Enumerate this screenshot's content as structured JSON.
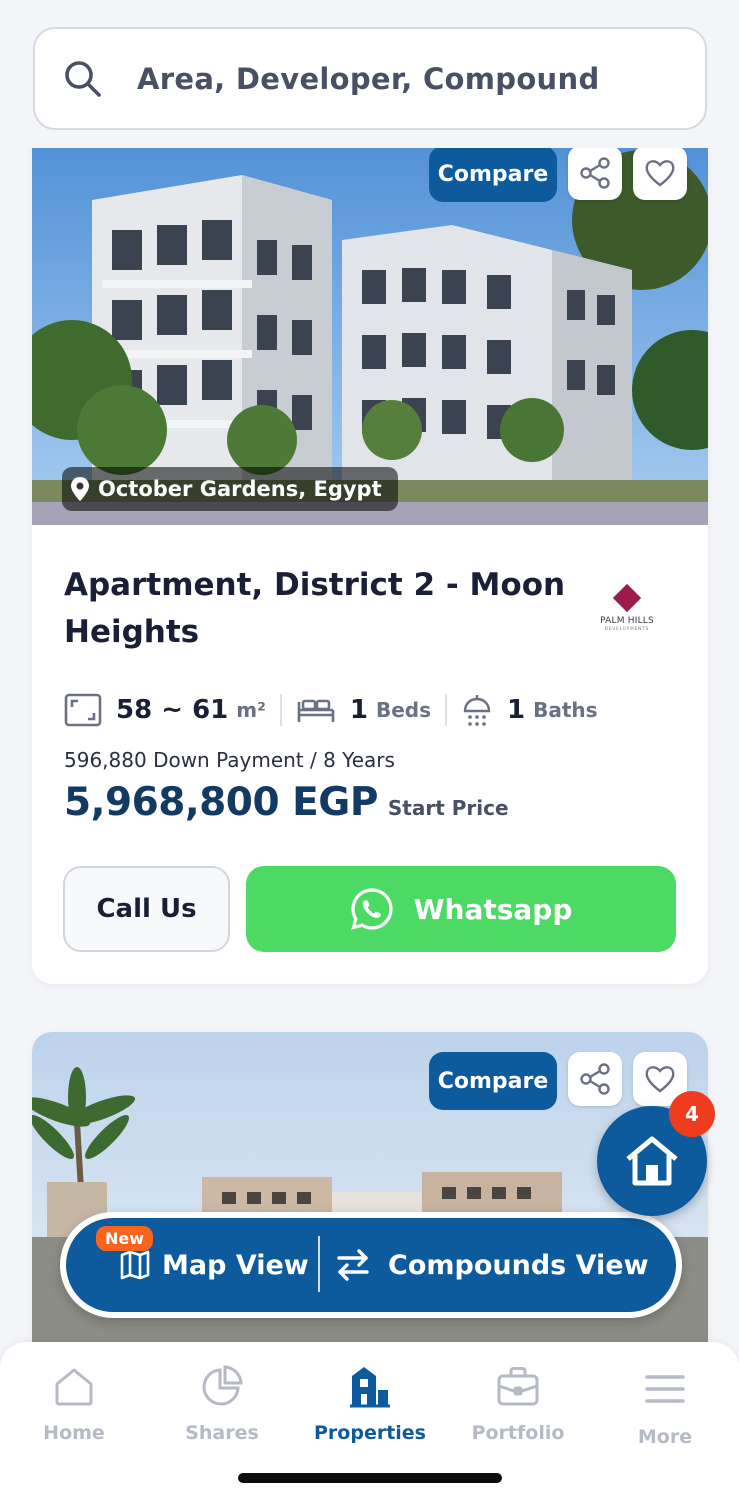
{
  "search": {
    "placeholder": "Area, Developer, Compound"
  },
  "listing": {
    "compare_label": "Compare",
    "location": "October Gardens, Egypt",
    "title": "Apartment, District 2 - Moon Heights",
    "developer_logo": {
      "name": "PALM HILLS",
      "sub": "DEVELOPMENTS"
    },
    "area": "58 ~ 61",
    "area_unit": "m²",
    "beds": "1",
    "beds_label": "Beds",
    "baths": "1",
    "baths_label": "Baths",
    "down_payment": "596,880 Down Payment / 8 Years",
    "price": "5,968,800 EGP",
    "price_label": "Start Price",
    "call_label": "Call Us",
    "whatsapp_label": "Whatsapp"
  },
  "listing2": {
    "compare_label": "Compare"
  },
  "fab": {
    "badge_count": "4"
  },
  "view_toggle": {
    "new_badge": "New",
    "map_label": "Map View",
    "compounds_label": "Compounds View"
  },
  "nav": {
    "items": [
      {
        "label": "Home",
        "icon": "home-icon"
      },
      {
        "label": "Shares",
        "icon": "pie-chart-icon"
      },
      {
        "label": "Properties",
        "icon": "buildings-icon"
      },
      {
        "label": "Portfolio",
        "icon": "briefcase-icon"
      },
      {
        "label": "More",
        "icon": "menu-icon"
      }
    ],
    "active_index": 2
  },
  "colors": {
    "primary": "#0d5a9c",
    "whatsapp": "#4cd964",
    "badge": "#f03c1e",
    "new_badge": "#f7641d"
  }
}
